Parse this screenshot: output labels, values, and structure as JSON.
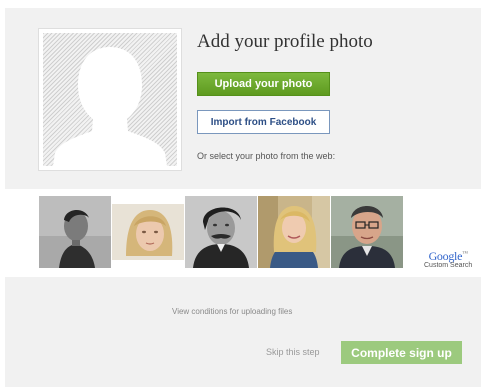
{
  "profile_photo": {
    "title": "Add your profile photo",
    "upload_label": "Upload your photo",
    "facebook_label": "Import from Facebook",
    "web_label": "Or select your photo from the web:"
  },
  "web_photos": [
    {
      "name": "web-photo-1",
      "style": "bw-man-profile"
    },
    {
      "name": "web-photo-2",
      "style": "color-woman-blonde-light"
    },
    {
      "name": "web-photo-3",
      "style": "bw-man-mustache"
    },
    {
      "name": "web-photo-4",
      "style": "color-woman-blonde"
    },
    {
      "name": "web-photo-5",
      "style": "color-man-glasses"
    }
  ],
  "google": {
    "logo": "Google",
    "trademark": "™",
    "caption": "Custom Search"
  },
  "footer": {
    "conditions": "View conditions for uploading files",
    "skip": "Skip this step",
    "complete": "Complete sign up"
  },
  "colors": {
    "upload_button": "#6aab2a",
    "facebook_border": "#7a97bd",
    "complete_button": "#9cca7e",
    "panel_background": "#f1f1f1"
  }
}
